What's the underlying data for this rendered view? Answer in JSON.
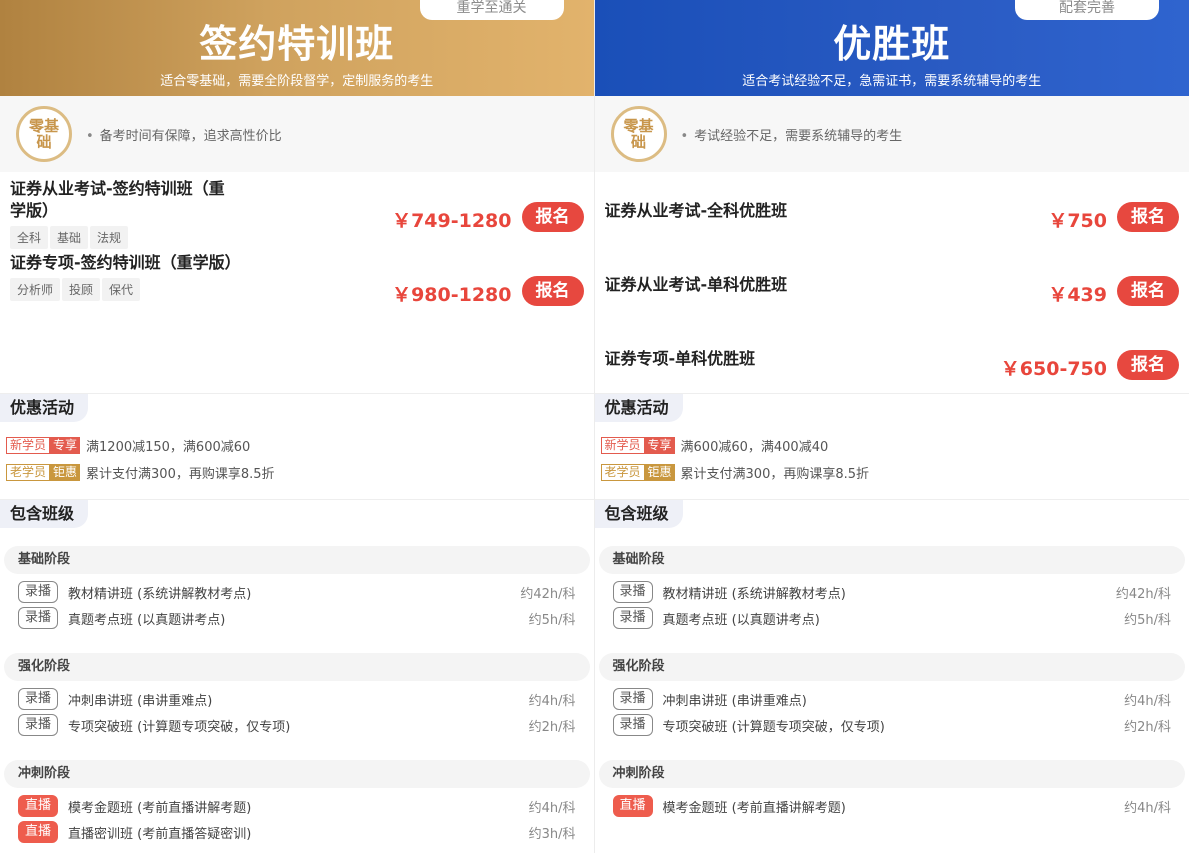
{
  "left": {
    "ribbon": "重学至通关",
    "title": "签约特训班",
    "subtitle": "适合零基础，需要全阶段督学，定制服务的考生",
    "badge": "零基础",
    "badge_desc": "备考时间有保障，追求高性价比",
    "products": [
      {
        "name": "证券从业考试-签约特训班（重学版）",
        "price": "￥749-1280",
        "tags": [
          "全科",
          "基础",
          "法规"
        ],
        "button": "报名"
      },
      {
        "name": "证券专项-签约特训班（重学版）",
        "price": "￥980-1280",
        "tags": [
          "分析师",
          "投顾",
          "保代"
        ],
        "button": "报名"
      }
    ],
    "promo_title": "优惠活动",
    "promos": [
      {
        "tag_a": "新学员",
        "tag_b": "专享",
        "style": "red",
        "text": "满1200减150，满600减60"
      },
      {
        "tag_a": "老学员",
        "tag_b": "钜惠",
        "style": "gold",
        "text": "累计支付满300，再购课享8.5折"
      }
    ],
    "classes_title": "包含班级",
    "stages": [
      {
        "name": "基础阶段",
        "lessons": [
          {
            "type": "录播",
            "kind": "rec",
            "name": "教材精讲班 (系统讲解教材考点)",
            "dur": "约42h/科"
          },
          {
            "type": "录播",
            "kind": "rec",
            "name": "真题考点班 (以真题讲考点)",
            "dur": "约5h/科"
          }
        ]
      },
      {
        "name": "强化阶段",
        "lessons": [
          {
            "type": "录播",
            "kind": "rec",
            "name": "冲刺串讲班 (串讲重难点)",
            "dur": "约4h/科"
          },
          {
            "type": "录播",
            "kind": "rec",
            "name": "专项突破班 (计算题专项突破，仅专项)",
            "dur": "约2h/科"
          }
        ]
      },
      {
        "name": "冲刺阶段",
        "lessons": [
          {
            "type": "直播",
            "kind": "live",
            "name": "模考金题班 (考前直播讲解考题)",
            "dur": "约4h/科"
          },
          {
            "type": "直播",
            "kind": "live",
            "name": "直播密训班 (考前直播答疑密训)",
            "dur": "约3h/科"
          }
        ]
      }
    ]
  },
  "right": {
    "ribbon": "配套完善",
    "title": "优胜班",
    "subtitle": "适合考试经验不足，急需证书，需要系统辅导的考生",
    "badge": "零基础",
    "badge_desc": "考试经验不足，需要系统辅导的考生",
    "products": [
      {
        "name": "证券从业考试-全科优胜班",
        "price": "￥750",
        "tags": [],
        "button": "报名"
      },
      {
        "name": "证券从业考试-单科优胜班",
        "price": "￥439",
        "tags": [],
        "button": "报名"
      },
      {
        "name": "证券专项-单科优胜班",
        "price": "￥650-750",
        "tags": [],
        "button": "报名"
      }
    ],
    "promo_title": "优惠活动",
    "promos": [
      {
        "tag_a": "新学员",
        "tag_b": "专享",
        "style": "red",
        "text": "满600减60，满400减40"
      },
      {
        "tag_a": "老学员",
        "tag_b": "钜惠",
        "style": "gold",
        "text": "累计支付满300，再购课享8.5折"
      }
    ],
    "classes_title": "包含班级",
    "stages": [
      {
        "name": "基础阶段",
        "lessons": [
          {
            "type": "录播",
            "kind": "rec",
            "name": "教材精讲班 (系统讲解教材考点)",
            "dur": "约42h/科"
          },
          {
            "type": "录播",
            "kind": "rec",
            "name": "真题考点班 (以真题讲考点)",
            "dur": "约5h/科"
          }
        ]
      },
      {
        "name": "强化阶段",
        "lessons": [
          {
            "type": "录播",
            "kind": "rec",
            "name": "冲刺串讲班 (串讲重难点)",
            "dur": "约4h/科"
          },
          {
            "type": "录播",
            "kind": "rec",
            "name": "专项突破班 (计算题专项突破，仅专项)",
            "dur": "约2h/科"
          }
        ]
      },
      {
        "name": "冲刺阶段",
        "lessons": [
          {
            "type": "直播",
            "kind": "live",
            "name": "模考金题班 (考前直播讲解考题)",
            "dur": "约4h/科"
          }
        ]
      }
    ]
  }
}
